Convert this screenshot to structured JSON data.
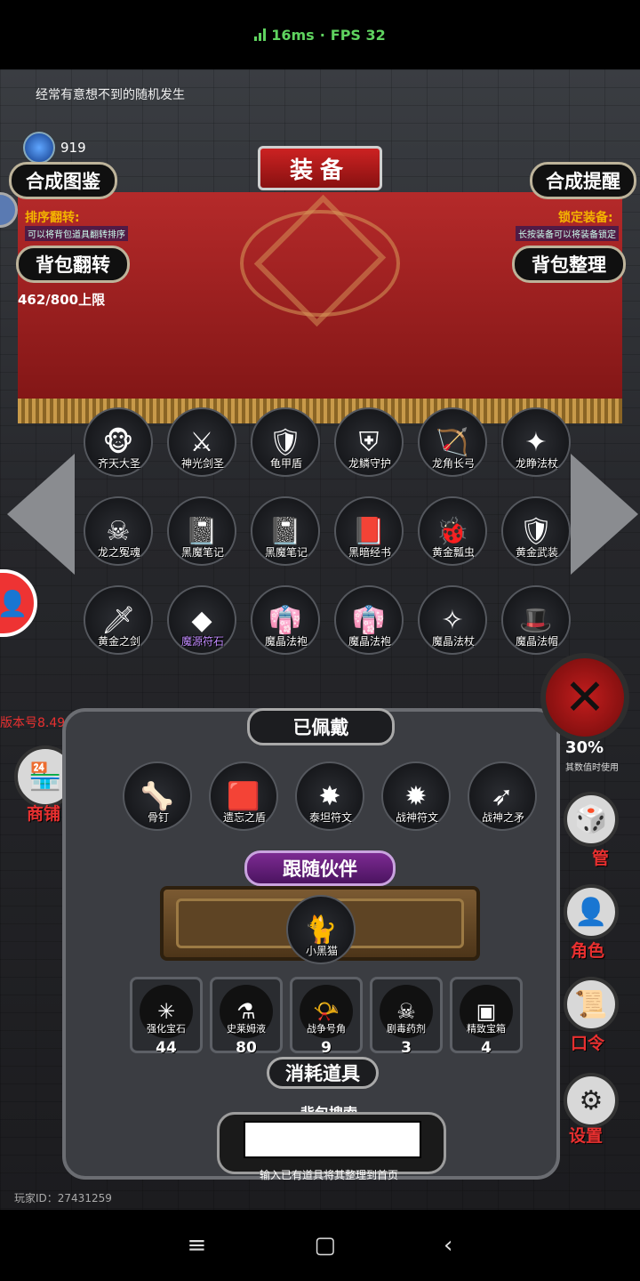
{
  "status": {
    "latency": "16ms",
    "separator": "·",
    "fps": "FPS 32"
  },
  "hint": "经常有意想不到的随机发生",
  "gem_count": "919",
  "title": "装备",
  "buttons": {
    "synth_catalog": "合成图鉴",
    "synth_reminder": "合成提醒",
    "bag_flip": "背包翻转",
    "bag_sort": "背包整理"
  },
  "info": {
    "sort_flip_label": "排序翻转:",
    "sort_flip_sub": "可以将背包道具翻转排序",
    "lock_label": "锁定装备:",
    "lock_sub": "长按装备可以将装备锁定"
  },
  "capacity": "462/800上限",
  "inventory": [
    {
      "name": "齐天大圣",
      "icon": "monkey-king-icon",
      "glyph": "🐵"
    },
    {
      "name": "神光剑圣",
      "icon": "knight-icon",
      "glyph": "⚔"
    },
    {
      "name": "龟甲盾",
      "icon": "turtle-shield-icon",
      "glyph": "🛡"
    },
    {
      "name": "龙鳞守护",
      "icon": "dragon-scale-icon",
      "glyph": "⛨"
    },
    {
      "name": "龙角长弓",
      "icon": "bow-icon",
      "glyph": "🏹"
    },
    {
      "name": "龙睁法杖",
      "icon": "staff-icon",
      "glyph": "✦"
    },
    {
      "name": "龙之冤魂",
      "icon": "skeleton-icon",
      "glyph": "☠"
    },
    {
      "name": "黑魔笔记",
      "icon": "book-icon",
      "glyph": "📓"
    },
    {
      "name": "黑魔笔记",
      "icon": "book-icon",
      "glyph": "📓"
    },
    {
      "name": "黑暗经书",
      "icon": "red-book-icon",
      "glyph": "📕"
    },
    {
      "name": "黄金瓢虫",
      "icon": "ladybug-icon",
      "glyph": "🐞"
    },
    {
      "name": "黄金武装",
      "icon": "armor-icon",
      "glyph": "🛡"
    },
    {
      "name": "黄金之剑",
      "icon": "sword-icon",
      "glyph": "🗡"
    },
    {
      "name": "魔源符石",
      "icon": "rune-stone-icon",
      "glyph": "◆",
      "purple": true
    },
    {
      "name": "魔晶法袍",
      "icon": "robe-icon",
      "glyph": "👘"
    },
    {
      "name": "魔晶法袍",
      "icon": "robe-icon",
      "glyph": "👘"
    },
    {
      "name": "魔晶法杖",
      "icon": "wand-icon",
      "glyph": "✧"
    },
    {
      "name": "魔晶法帽",
      "icon": "wizard-hat-icon",
      "glyph": "🎩"
    }
  ],
  "equipped_title": "已佩戴",
  "equipped": [
    {
      "name": "骨钉",
      "icon": "bone-nail-icon",
      "glyph": "🦴"
    },
    {
      "name": "遗忘之盾",
      "icon": "shield-icon",
      "glyph": "🟥"
    },
    {
      "name": "泰坦符文",
      "icon": "rune-icon",
      "glyph": "✸"
    },
    {
      "name": "战神符文",
      "icon": "rune-icon",
      "glyph": "✹"
    },
    {
      "name": "战神之矛",
      "icon": "spear-icon",
      "glyph": "➶"
    }
  ],
  "companion_title": "跟随伙伴",
  "companion": {
    "name": "小黑猫",
    "icon": "cat-icon",
    "glyph": "🐈"
  },
  "consumables_title": "消耗道具",
  "consumables": [
    {
      "name": "强化宝石",
      "count": "44",
      "icon": "gem-icon",
      "glyph": "✳"
    },
    {
      "name": "史莱姆液",
      "count": "80",
      "icon": "potion-icon",
      "glyph": "⚗"
    },
    {
      "name": "战争号角",
      "count": "9",
      "icon": "horn-icon",
      "glyph": "📯"
    },
    {
      "name": "剧毒药剂",
      "count": "3",
      "icon": "poison-icon",
      "glyph": "☠"
    },
    {
      "name": "精致宝箱",
      "count": "4",
      "icon": "chest-icon",
      "glyph": "▣"
    }
  ],
  "search": {
    "title": "背包搜索",
    "value": "",
    "hint": "输入已有道具将其整理到首页"
  },
  "player_id": "玩家ID：27431259",
  "version": "版本号8.49",
  "side": {
    "manager": "管",
    "role": "角色",
    "code": "口令",
    "settings": "设置",
    "shop": "商铺",
    "tag_30": "30%",
    "tag_30_sub": "其数值时使用"
  },
  "colors": {
    "banner": "#b52a2a",
    "accent_red": "#e83030",
    "gold": "#f4b400",
    "ping_green": "#5fd35f"
  }
}
